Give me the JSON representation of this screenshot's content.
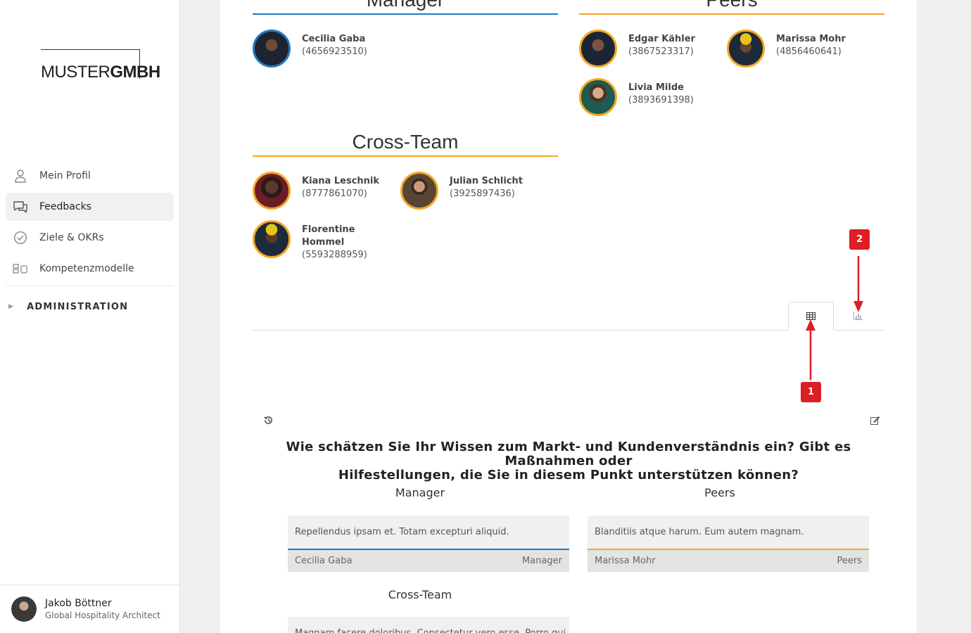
{
  "brand": {
    "logo_light": "MUSTER",
    "logo_bold": "GMBH"
  },
  "sidebar": {
    "items": [
      {
        "label": "Mein Profil",
        "icon": "user-icon"
      },
      {
        "label": "Feedbacks",
        "icon": "chat-bubbles-icon",
        "active": true
      },
      {
        "label": "Ziele & OKRs",
        "icon": "check-circle-icon"
      },
      {
        "label": "Kompetenzmodelle",
        "icon": "blocks-icon"
      }
    ],
    "admin_label": "ADMINISTRATION"
  },
  "user": {
    "name": "Jakob Böttner",
    "role": "Global Hospitality Architect"
  },
  "groups": {
    "manager": {
      "title": "Manager",
      "people": [
        {
          "name": "Cecilia Gaba",
          "id": "(4656923510)"
        }
      ]
    },
    "peers": {
      "title": "Peers",
      "people": [
        {
          "name": "Edgar Kähler",
          "id": "(3867523317)"
        },
        {
          "name": "Marissa Mohr",
          "id": "(4856460641)"
        },
        {
          "name": "Livia Milde",
          "id": "(3893691398)"
        }
      ]
    },
    "cross_team": {
      "title": "Cross-Team",
      "people": [
        {
          "name": "Kiana Leschnik",
          "id": "(8777861070)"
        },
        {
          "name": "Julian Schlicht",
          "id": "(3925897436)"
        },
        {
          "name_line1": "Florentine",
          "name_line2": "Hommel",
          "id": "(5593288959)"
        }
      ]
    }
  },
  "tabs": {
    "table_icon": "table-icon",
    "chart_icon": "bar-chart-icon"
  },
  "markers": {
    "one": "1",
    "two": "2"
  },
  "question": {
    "line1": "Wie schätzen Sie Ihr Wissen zum Markt- und Kundenverständnis ein? Gibt es Maßnahmen oder",
    "line2": "Hilfestellungen, die Sie in diesem Punkt unterstützen können?"
  },
  "answers": {
    "manager": {
      "label": "Manager",
      "text": "Repellendus ipsam et. Totam excepturi aliquid.",
      "author": "Cecilia Gaba",
      "role": "Manager"
    },
    "peers": {
      "label": "Peers",
      "text": "Blanditiis atque harum. Eum autem magnam.",
      "author": "Marissa Mohr",
      "role": "Peers"
    },
    "cross_team": {
      "label": "Cross-Team",
      "text": "Magnam facere doloribus. Consectetur vero esse. Porro qui"
    }
  },
  "colors": {
    "manager": "#1e7ac4",
    "peers": "#f5a623",
    "marker": "#dc1e26"
  }
}
